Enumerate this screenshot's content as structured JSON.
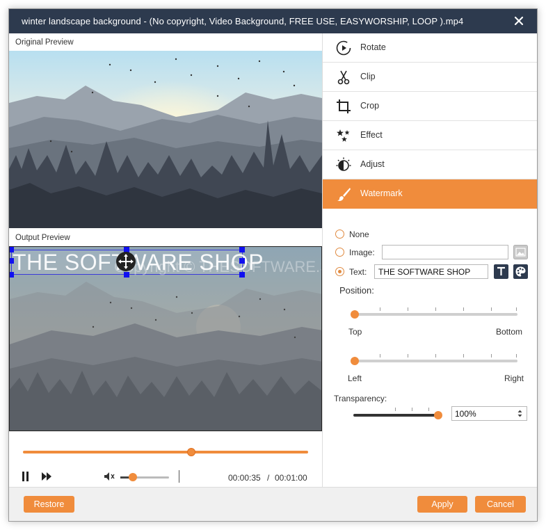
{
  "window": {
    "title": "winter landscape background - (No copyright, Video Background, FREE USE, EASYWORSHIP, LOOP ).mp4"
  },
  "previews": {
    "original_label": "Original Preview",
    "output_label": "Output Preview"
  },
  "watermark_overlay": {
    "text": "THE SOFTWARE SHOP",
    "faint_text": "Copyright © THESOFTWARE.SHOP"
  },
  "playback": {
    "progress_fraction": 0.59,
    "volume_fraction": 0.27,
    "current_time": "00:00:35",
    "separator": "/",
    "total_time": "00:01:00"
  },
  "menu": {
    "items": [
      {
        "label": "Rotate",
        "icon": "rotate-icon"
      },
      {
        "label": "Clip",
        "icon": "scissors-icon"
      },
      {
        "label": "Crop",
        "icon": "crop-icon"
      },
      {
        "label": "Effect",
        "icon": "effect-stars-icon"
      },
      {
        "label": "Adjust",
        "icon": "adjust-icon"
      },
      {
        "label": "Watermark",
        "icon": "brush-icon"
      }
    ],
    "active": "Watermark"
  },
  "watermark_panel": {
    "none_label": "None",
    "image_label": "Image:",
    "image_value": "",
    "text_label": "Text:",
    "text_value": "THE SOFTWARE SHOP",
    "selected": "text",
    "position_label": "Position:",
    "vertical": {
      "min_label": "Top",
      "max_label": "Bottom",
      "value": 0
    },
    "horizontal": {
      "min_label": "Left",
      "max_label": "Right",
      "value": 0
    },
    "transparency_label": "Transparency:",
    "transparency_value": "100%",
    "transparency_fraction": 1.0
  },
  "footer": {
    "restore_label": "Restore",
    "apply_label": "Apply",
    "cancel_label": "Cancel"
  },
  "colors": {
    "accent": "#f08c3c",
    "titlebar": "#2d3a4e",
    "handle": "#1010f0"
  }
}
